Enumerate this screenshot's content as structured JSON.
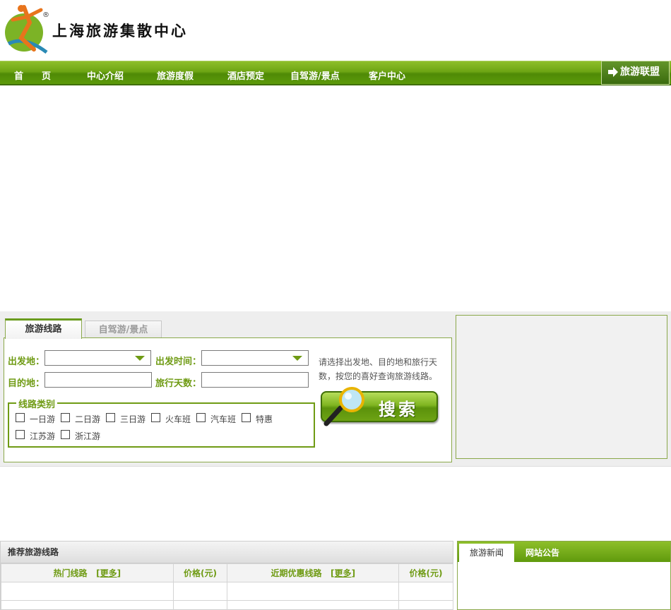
{
  "header": {
    "logo_text": "上海旅游集散中心",
    "logo_mark": "®"
  },
  "nav": {
    "items": [
      "首　　页",
      "中心介绍",
      "旅游度假",
      "酒店预定",
      "自驾游/景点",
      "客户中心"
    ],
    "alliance_label": "旅游联盟"
  },
  "search": {
    "tabs": [
      "旅游线路",
      "自驾游/景点"
    ],
    "labels": {
      "depart": "出发地：",
      "depart_time": "出发时间：",
      "destination": "目的地：",
      "days": "旅行天数："
    },
    "depart_value": "",
    "depart_time_value": "",
    "destination_value": "",
    "days_value": "",
    "category_legend": "线路类别",
    "categories": [
      "一日游",
      "二日游",
      "三日游",
      "火车班",
      "汽车班",
      "特惠",
      "江苏游",
      "浙江游"
    ],
    "hint": "请选择出发地、目的地和旅行天数，按您的喜好查询旅游线路。",
    "button_label": "搜索"
  },
  "recommend": {
    "title": "推荐旅游线路",
    "col_hot": "热门线路",
    "col_price": "价格(元)",
    "col_deals": "近期优惠线路",
    "more": "更多"
  },
  "news": {
    "tabs": [
      "旅游新闻",
      "网站公告"
    ]
  },
  "colors": {
    "brand_green": "#6f9b14",
    "nav_green": "#5c9a0a"
  }
}
